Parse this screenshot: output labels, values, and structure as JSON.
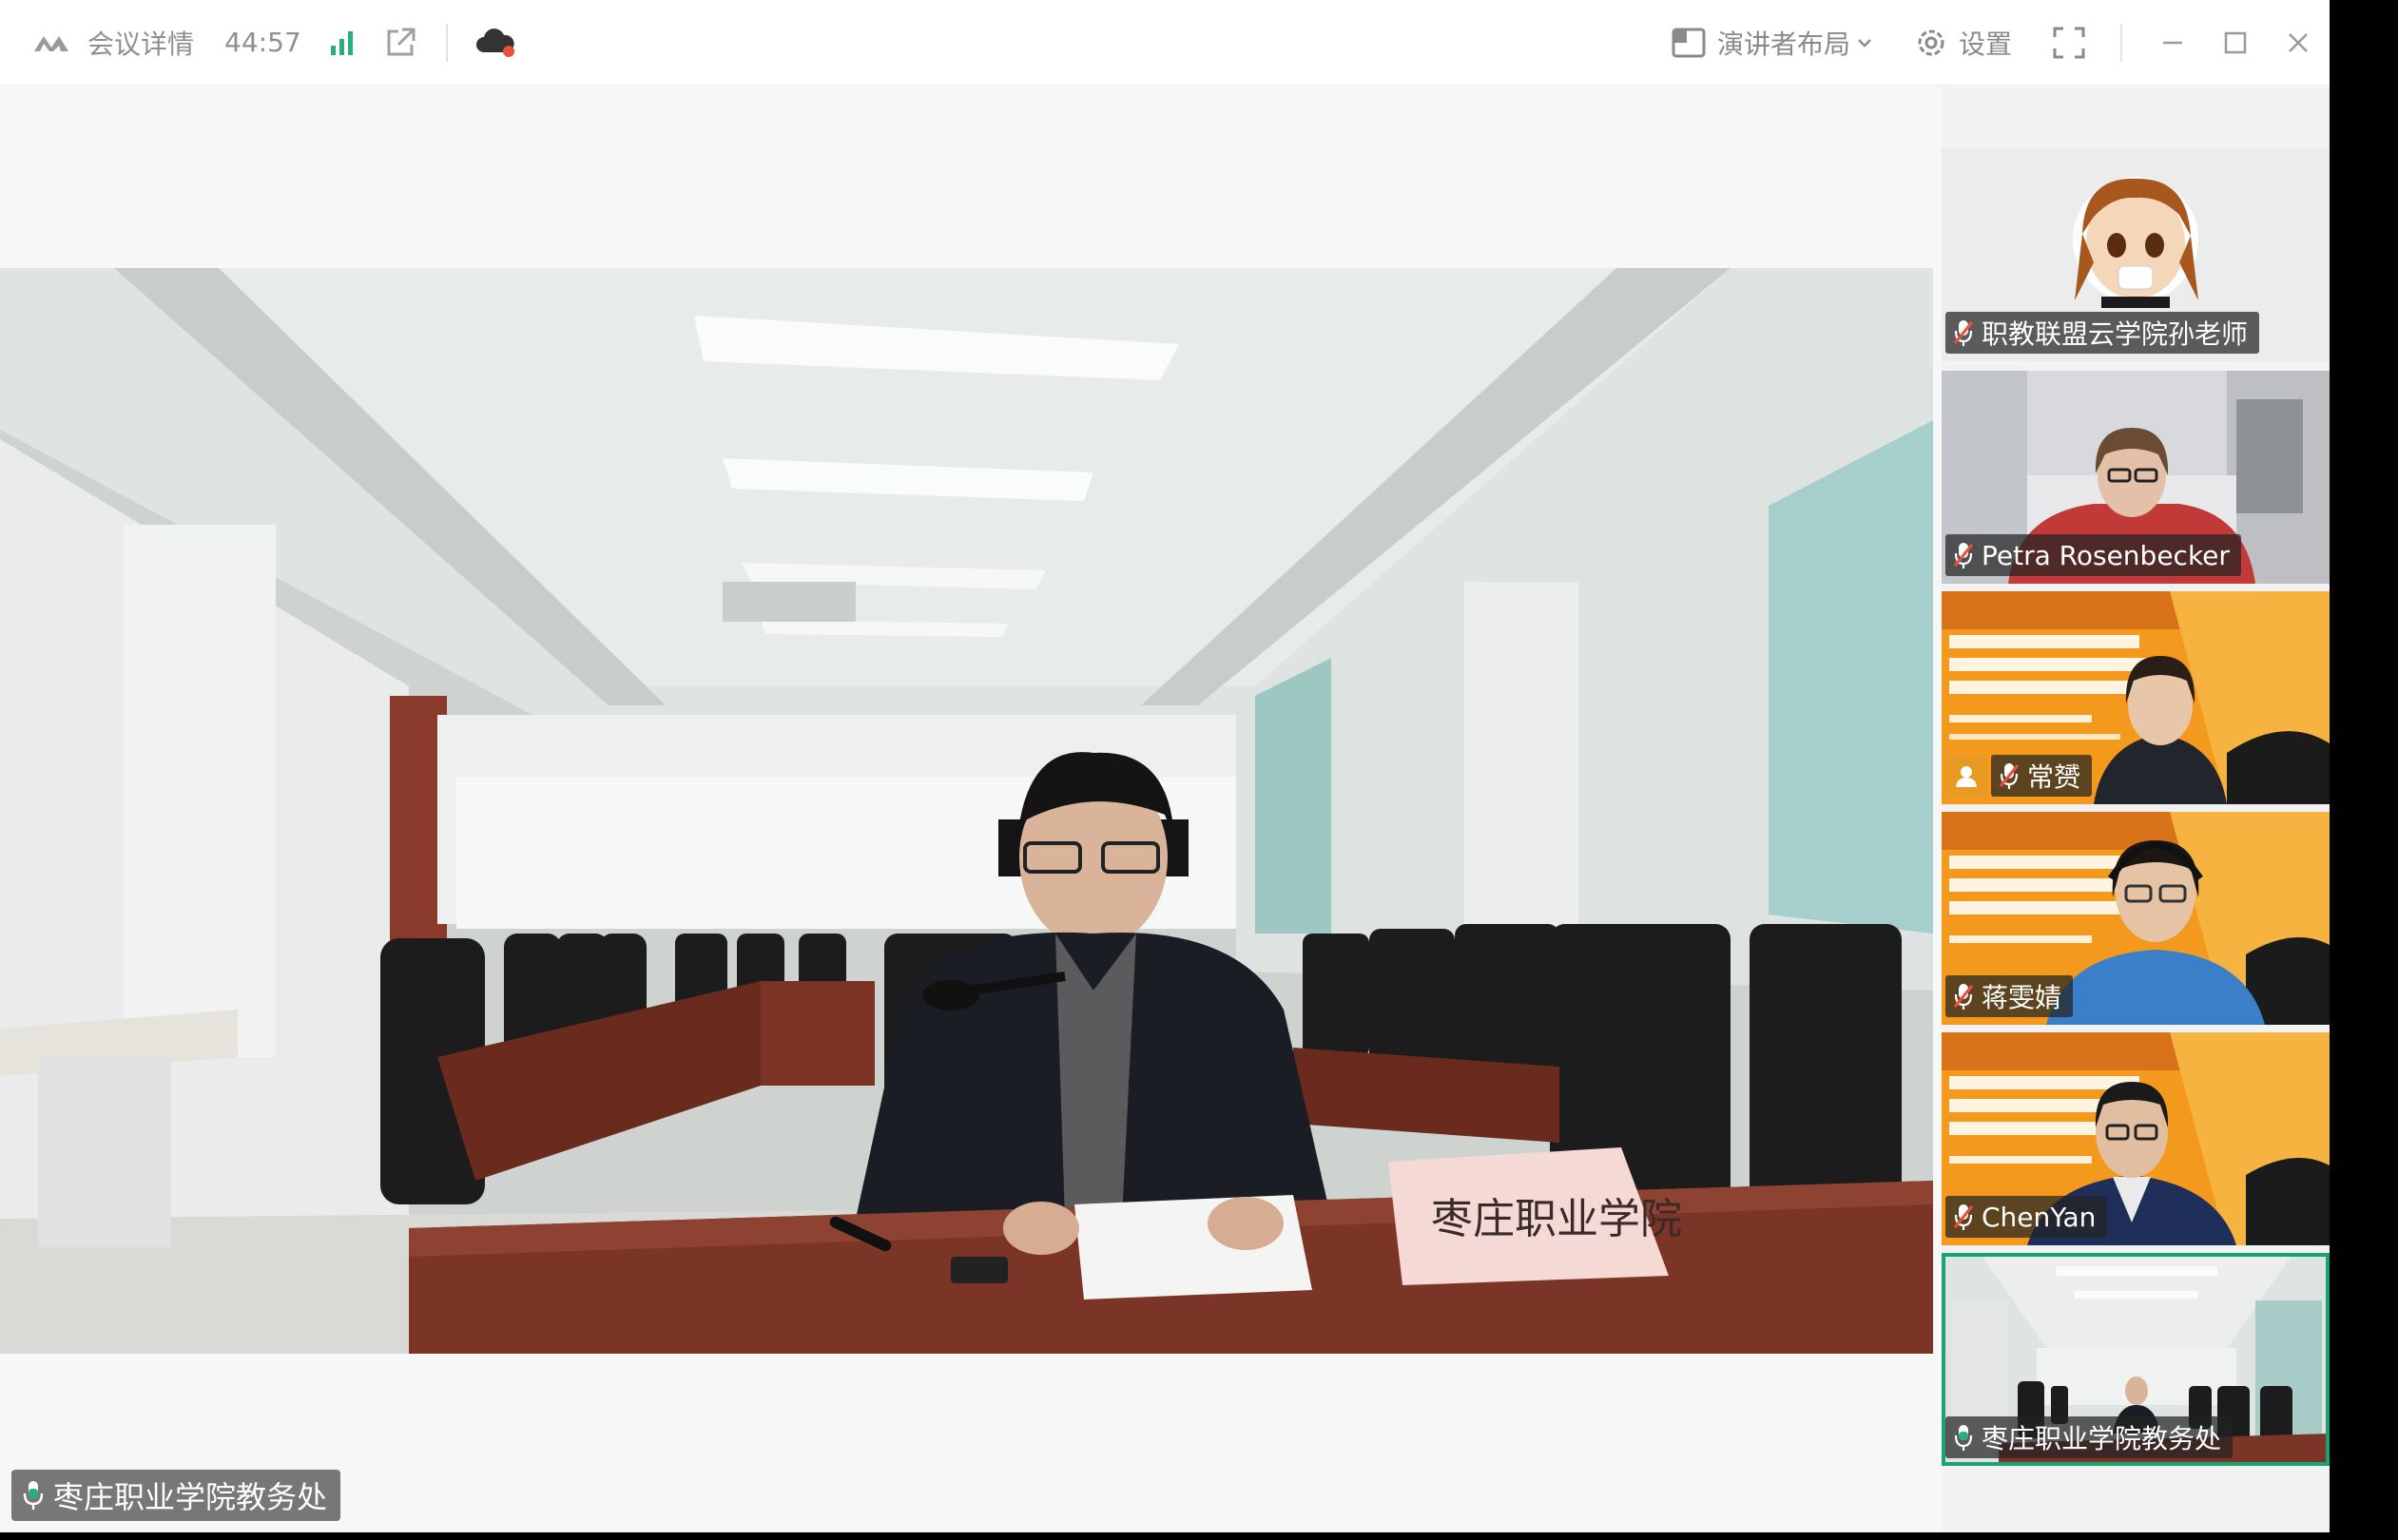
{
  "topbar": {
    "meeting_details_label": "会议详情",
    "timer": "44:57",
    "layout_label": "演讲者布局",
    "settings_label": "设置"
  },
  "main": {
    "speaker_name": "枣庄职业学院教务处",
    "nameplate_text": "枣庄职业学院"
  },
  "participants": [
    {
      "name": "职教联盟云学院孙老师"
    },
    {
      "name": "Petra Rosenbecker"
    },
    {
      "name": "常赟"
    },
    {
      "name": "蒋雯婧"
    },
    {
      "name": "ChenYan"
    },
    {
      "name": "枣庄职业学院教务处"
    }
  ],
  "colors": {
    "accent": "#1aa36f",
    "signal": "#27b07a",
    "mic_active": "#e8503a",
    "banner_orange": "#f39a1e"
  }
}
